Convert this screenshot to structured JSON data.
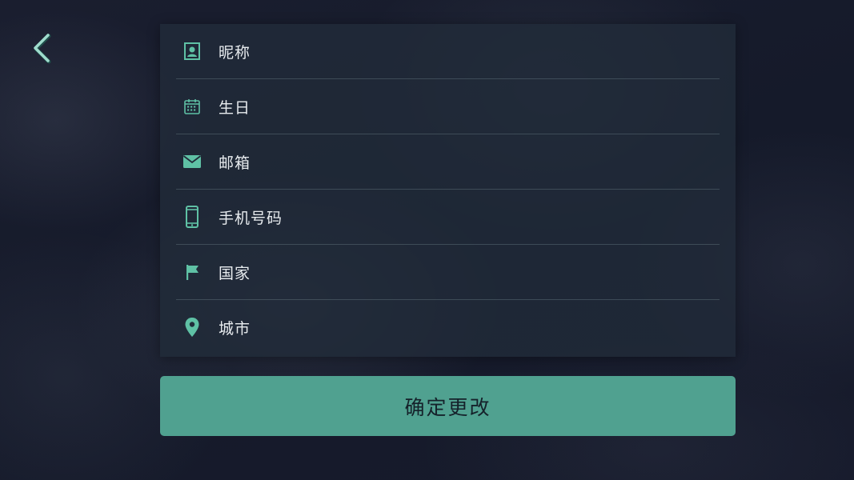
{
  "colors": {
    "accent": "#50a190",
    "icon": "#5fc1a5",
    "background": "#161a2a",
    "panel": "#212c3a",
    "text": "#e8ecef"
  },
  "header": {
    "back_icon": "chevron-left-icon"
  },
  "form": {
    "fields": [
      {
        "label": "昵称",
        "icon": "contact-card-icon"
      },
      {
        "label": "生日",
        "icon": "calendar-icon"
      },
      {
        "label": "邮箱",
        "icon": "envelope-icon"
      },
      {
        "label": "手机号码",
        "icon": "smartphone-icon"
      },
      {
        "label": "国家",
        "icon": "flag-icon"
      },
      {
        "label": "城市",
        "icon": "map-pin-icon"
      }
    ]
  },
  "actions": {
    "confirm_label": "确定更改"
  }
}
